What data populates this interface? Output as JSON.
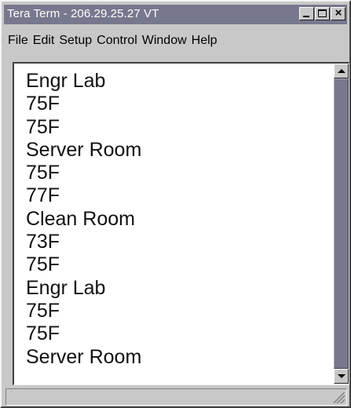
{
  "window": {
    "title": "Tera Term - 206.29.25.27 VT"
  },
  "title_buttons": {
    "minimize_icon": "minimize-icon",
    "maximize_icon": "maximize-icon",
    "close_icon": "close-icon",
    "close_glyph": "×"
  },
  "menu": {
    "items": [
      {
        "label": "File"
      },
      {
        "label": "Edit"
      },
      {
        "label": "Setup"
      },
      {
        "label": "Control"
      },
      {
        "label": "Window"
      },
      {
        "label": "Help"
      }
    ]
  },
  "terminal": {
    "lines": [
      "Engr Lab",
      "75F",
      "75F",
      "Server Room",
      "75F",
      "77F",
      "Clean Room",
      "73F",
      "75F",
      "Engr Lab",
      "75F",
      "75F",
      "Server Room"
    ]
  },
  "colors": {
    "titlebar": "#77788e",
    "chrome": "#c8c8c8",
    "terminal_bg": "#ffffff",
    "scroll_thumb": "#77788e"
  }
}
